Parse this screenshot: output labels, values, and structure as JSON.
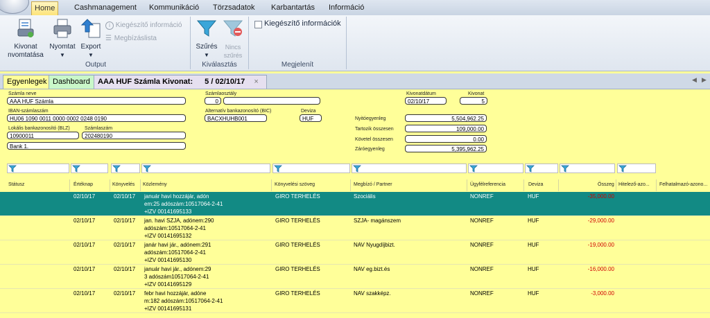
{
  "menu": {
    "tabs": [
      {
        "label": "Home",
        "active": true
      },
      {
        "label": "Cashmanagement"
      },
      {
        "label": "Kommunikáció"
      },
      {
        "label": "Törzsadatok"
      },
      {
        "label": "Karbantartás"
      },
      {
        "label": "Információ"
      }
    ]
  },
  "ribbon": {
    "output": {
      "label": "Output",
      "kivonat": "Kivonat nvomtatása",
      "nyomtat": "Nyomtat",
      "export": "Export",
      "kiegeszito": "Kiegészítő információ",
      "megbizaslista": "Megbízáslista"
    },
    "kivalasztas": {
      "label": "Kiválasztás",
      "szures": "Szűrés",
      "nincs_szures_1": "Nincs",
      "nincs_szures_2": "szűrés"
    },
    "megjelenit": {
      "label": "Megjelenít",
      "kiegeszito_informaciok": "Kiegészítő információk"
    }
  },
  "doc_tabs": {
    "egyenlegek": "Egyenlegek",
    "dashboard": "Dashboard",
    "active_title": "AAA HUF Számla Kivonat:",
    "active_number": "5 / 02/10/17",
    "close": "×"
  },
  "header": {
    "szamla_neve_label": "Számla neve",
    "szamla_neve": "AAA HUF Számla",
    "szamlaosztaly_label": "Számlaosztály",
    "szamlaosztaly": "0",
    "kivonatdatum_label": "Kivonatdátum",
    "kivonatdatum": "02/10/17",
    "kivonat_label": "Kivonat",
    "kivonat": "5",
    "iban_label": "IBAN-számlaszám",
    "iban": "HU06 1090 0011 0000 0002 0248 0190",
    "bic_label": "Alternatív bankazonosító (BIC)",
    "bic": "BACXHUHB001",
    "deviza_label": "Deviza",
    "deviza": "HUF",
    "blz_label": "Lokális bankazonosító (BLZ)",
    "blz": "10900011",
    "szamlaszam_label": "Számlaszám",
    "szamlaszam": "202480190",
    "bank": "Bank 1.",
    "nyito_label": "Nyitóegyenleg",
    "nyito": "5,504,962.25",
    "tartozik_label": "Tartozik összesen",
    "tartozik": "109,000.00",
    "kovetel_label": "Követel összesen",
    "kovetel": "0.00",
    "zaro_label": "Záróegyenleg",
    "zaro": "5,395,962.25"
  },
  "grid": {
    "headers": {
      "statusz": "Státusz",
      "erteknap": "Értéknap",
      "konyveles": "Könyvelés",
      "kozlemeny": "Közlemény",
      "konyvelesi_szoveg": "Könyvelési szöveg",
      "megbizo": "Megbízó / Partner",
      "ugyfelref": "Ügyfélreferencia",
      "deviza": "Deviza",
      "osszeg": "Összeg",
      "hitelezo": "Hitelező-azo...",
      "felhatalmazo": "Felhatalmazó-azono..."
    },
    "rows": [
      {
        "erteknap": "02/10/17",
        "konyveles": "02/10/17",
        "kozlemeny": [
          "január havi hozzájár,  adón",
          "em:25 adószám:10517064-2-41",
          "+IZV 00141695133"
        ],
        "szoveg": "GIRO TERHELÉS",
        "partner": "Szociális",
        "ref": "NONREF",
        "deviza": "HUF",
        "osszeg": "-35,000.00"
      },
      {
        "erteknap": "02/10/17",
        "konyveles": "02/10/17",
        "kozlemeny": [
          "jan. havi SZJA, adónem:290",
          "adószám:10517064-2-41",
          "+IZV 00141695132"
        ],
        "szoveg": "GIRO TERHELÉS",
        "partner": "SZJA-  magánszem",
        "ref": "NONREF",
        "deviza": "HUF",
        "osszeg": "-29,000.00"
      },
      {
        "erteknap": "02/10/17",
        "konyveles": "02/10/17",
        "kozlemeny": [
          "janár havi jár., adónem:291",
          "adószám:10517064-2-41",
          "+IZV 00141695130"
        ],
        "szoveg": "GIRO TERHELÉS",
        "partner": "NAV Nyugdíjbizt.",
        "ref": "NONREF",
        "deviza": "HUF",
        "osszeg": "-19,000.00"
      },
      {
        "erteknap": "02/10/17",
        "konyveles": "02/10/17",
        "kozlemeny": [
          "január havi jár., adónem:29",
          "3     adószám10517064-2-41",
          "+IZV 00141695129"
        ],
        "szoveg": "GIRO TERHELÉS",
        "partner": "NAV eg.bizt.és",
        "ref": "NONREF",
        "deviza": "HUF",
        "osszeg": "-16,000.00"
      },
      {
        "erteknap": "02/10/17",
        "konyveles": "02/10/17",
        "kozlemeny": [
          "febr havi hozzájár,  adóne",
          "m:182 adószám:10517064-2-41",
          "+IZV 00141695131"
        ],
        "szoveg": "GIRO TERHELÉS",
        "partner": "NAV szakképz.",
        "ref": "NONREF",
        "deviza": "HUF",
        "osszeg": "-3,000.00"
      }
    ]
  },
  "colors": {
    "background": "#ffff99",
    "selected_row": "#128a84",
    "negative_amount": "#d00000"
  }
}
